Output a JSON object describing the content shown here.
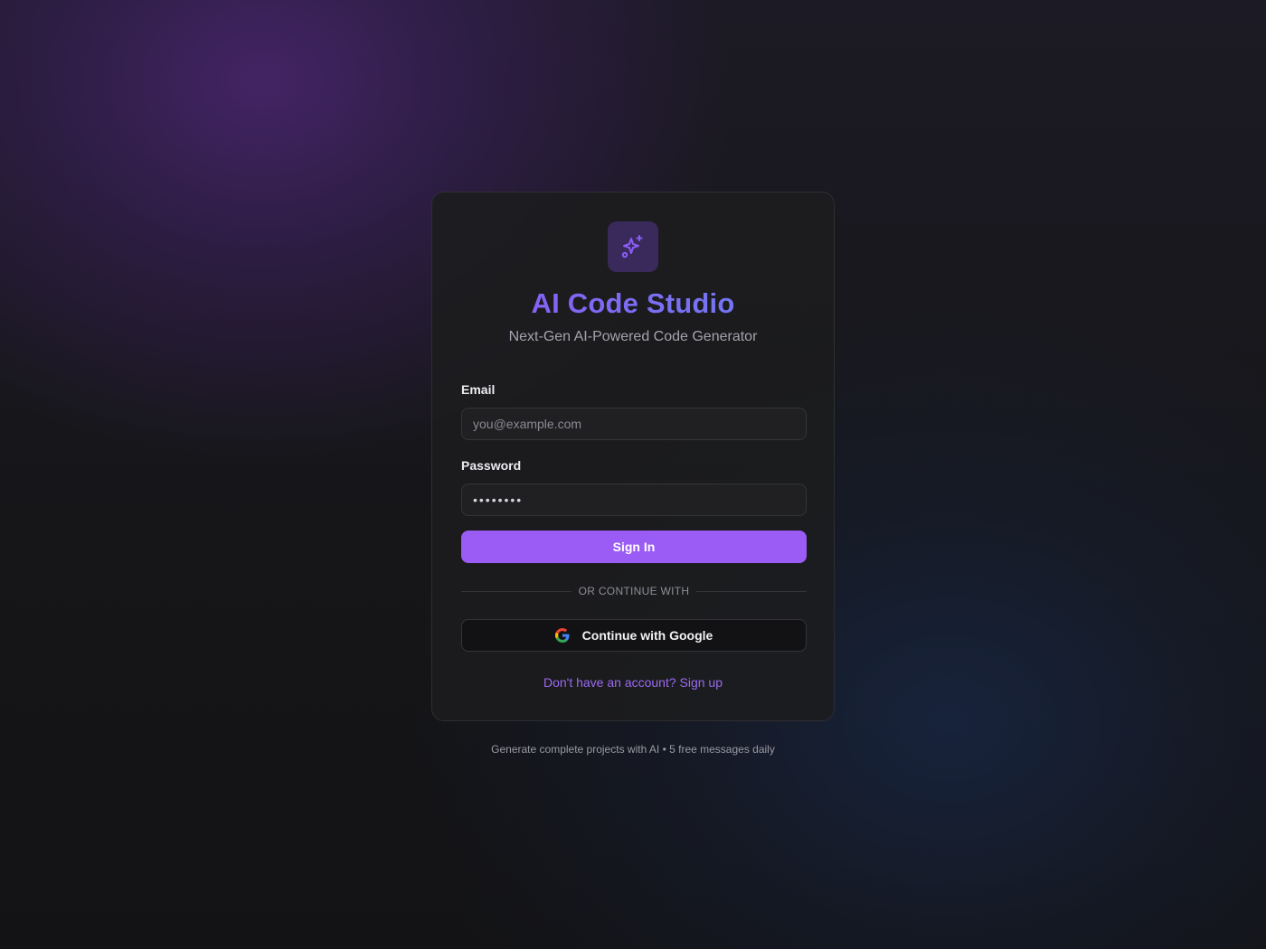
{
  "app": {
    "title": "AI Code Studio",
    "subtitle": "Next-Gen AI-Powered Code Generator",
    "logo_icon": "sparkles-icon",
    "accent_color": "#9b5cf6"
  },
  "form": {
    "email_label": "Email",
    "email_placeholder": "you@example.com",
    "email_value": "",
    "password_label": "Password",
    "password_value": "••••••••",
    "signin_label": "Sign In",
    "divider_text": "OR CONTINUE WITH",
    "google_label": "Continue with Google",
    "google_icon": "google-icon",
    "signup_link": "Don't have an account? Sign up"
  },
  "footer": {
    "text": "Generate complete projects with AI • 5 free messages daily"
  }
}
